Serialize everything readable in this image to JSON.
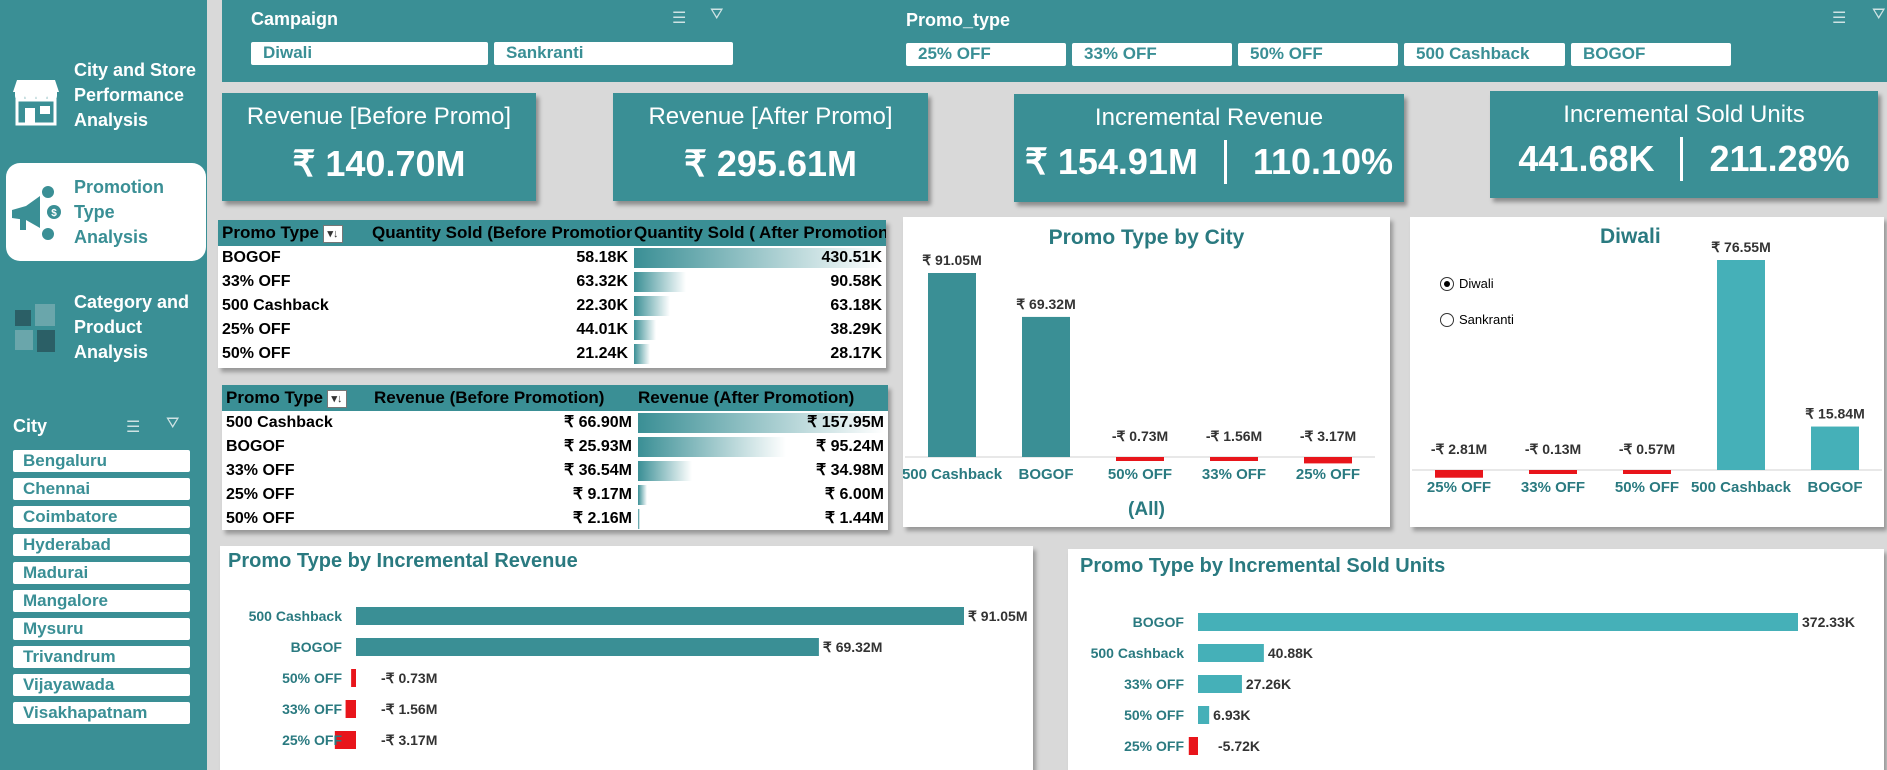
{
  "sidebar": {
    "nav": [
      {
        "label_lines": [
          "City and Store",
          "Performance",
          "Analysis"
        ],
        "icon": "store-icon"
      },
      {
        "label_lines": [
          "Promotion Type",
          "Analysis"
        ],
        "icon": "megaphone-icon",
        "active": true
      },
      {
        "label_lines": [
          "Category and",
          "Product",
          "Analysis"
        ],
        "icon": "boxes-icon"
      }
    ],
    "city_label": "City",
    "cities": [
      "Bengaluru",
      "Chennai",
      "Coimbatore",
      "Hyderabad",
      "Madurai",
      "Mangalore",
      "Mysuru",
      "Trivandrum",
      "Vijayawada",
      "Visakhapatnam"
    ]
  },
  "filters": {
    "campaign_label": "Campaign",
    "campaigns": [
      "Diwali",
      "Sankranti"
    ],
    "promo_label": "Promo_type",
    "promos": [
      "25% OFF",
      "33% OFF",
      "50% OFF",
      "500 Cashback",
      "BOGOF"
    ]
  },
  "kpis": {
    "rev_before": {
      "title": "Revenue [Before Promo]",
      "value": "₹ 140.70M"
    },
    "rev_after": {
      "title": "Revenue [After Promo]",
      "value": "₹ 295.61M"
    },
    "incr_rev": {
      "title": "Incremental Revenue",
      "value": "₹ 154.91M",
      "pct": "110.10%"
    },
    "incr_units": {
      "title": "Incremental Sold Units",
      "value": "441.68K",
      "pct": "211.28%"
    }
  },
  "qty_table": {
    "headers": [
      "Promo Type",
      "Quantity Sold (Before Promotion)",
      "Quantity Sold ( After Promotion)"
    ],
    "rows": [
      {
        "type": "BOGOF",
        "before": "58.18K",
        "after": "430.51K",
        "frac": 1.0
      },
      {
        "type": "33% OFF",
        "before": "63.32K",
        "after": "90.58K",
        "frac": 0.21
      },
      {
        "type": "500 Cashback",
        "before": "22.30K",
        "after": "63.18K",
        "frac": 0.147
      },
      {
        "type": "25% OFF",
        "before": "44.01K",
        "after": "38.29K",
        "frac": 0.089
      },
      {
        "type": "50% OFF",
        "before": "21.24K",
        "after": "28.17K",
        "frac": 0.065
      }
    ]
  },
  "rev_table": {
    "headers": [
      "Promo Type",
      "Revenue (Before Promotion)",
      "Revenue (After Promotion)"
    ],
    "rows": [
      {
        "type": "500 Cashback",
        "before": "₹ 66.90M",
        "after": "₹ 157.95M",
        "frac": 1.0
      },
      {
        "type": "BOGOF",
        "before": "₹ 25.93M",
        "after": "₹ 95.24M",
        "frac": 0.603
      },
      {
        "type": "33% OFF",
        "before": "₹ 36.54M",
        "after": "₹ 34.98M",
        "frac": 0.221
      },
      {
        "type": "25% OFF",
        "before": "₹ 9.17M",
        "after": "₹ 6.00M",
        "frac": 0.038
      },
      {
        "type": "50% OFF",
        "before": "₹ 2.16M",
        "after": "₹ 1.44M",
        "frac": 0.009
      }
    ]
  },
  "city_chart": {
    "title": "Promo Type by City",
    "filter_label": "(All)"
  },
  "campaign_chart": {
    "title": "Diwali",
    "radio_options": [
      "Diwali",
      "Sankranti"
    ],
    "selected": "Diwali"
  },
  "incr_rev_chart": {
    "title": "Promo Type by Incremental Revenue"
  },
  "incr_units_chart": {
    "title": "Promo Type by Incremental Sold Units"
  },
  "colors": {
    "teal": "#3a8f95",
    "teal_light": "#45b0b8",
    "negative": "#e8151b"
  },
  "chart_data": [
    {
      "type": "bar",
      "title": "Promo Type by City",
      "categories": [
        "500 Cashback",
        "BOGOF",
        "50% OFF",
        "33% OFF",
        "25% OFF"
      ],
      "values": [
        91.05,
        69.32,
        -0.73,
        -1.56,
        -3.17
      ],
      "labels": [
        "₹ 91.05M",
        "₹ 69.32M",
        "-₹ 0.73M",
        "-₹ 1.56M",
        "-₹ 3.17M"
      ]
    },
    {
      "type": "bar",
      "title": "Diwali",
      "categories": [
        "25% OFF",
        "33% OFF",
        "50% OFF",
        "500 Cashback",
        "BOGOF"
      ],
      "values": [
        -2.81,
        -0.13,
        -0.57,
        76.55,
        15.84
      ],
      "labels": [
        "-₹ 2.81M",
        "-₹ 0.13M",
        "-₹ 0.57M",
        "₹ 76.55M",
        "₹ 15.84M"
      ]
    },
    {
      "type": "bar",
      "orientation": "horizontal",
      "title": "Promo Type by Incremental Revenue",
      "categories": [
        "500 Cashback",
        "BOGOF",
        "50% OFF",
        "33% OFF",
        "25% OFF"
      ],
      "values": [
        91.05,
        69.32,
        -0.73,
        -1.56,
        -3.17
      ],
      "labels": [
        "₹ 91.05M",
        "₹ 69.32M",
        "-₹ 0.73M",
        "-₹ 1.56M",
        "-₹ 3.17M"
      ]
    },
    {
      "type": "bar",
      "orientation": "horizontal",
      "title": "Promo Type by Incremental Sold Units",
      "categories": [
        "BOGOF",
        "500 Cashback",
        "33% OFF",
        "50% OFF",
        "25% OFF"
      ],
      "values": [
        372.33,
        40.88,
        27.26,
        6.93,
        -5.72
      ],
      "labels": [
        "372.33K",
        "40.88K",
        "27.26K",
        "6.93K",
        "-5.72K"
      ]
    }
  ]
}
